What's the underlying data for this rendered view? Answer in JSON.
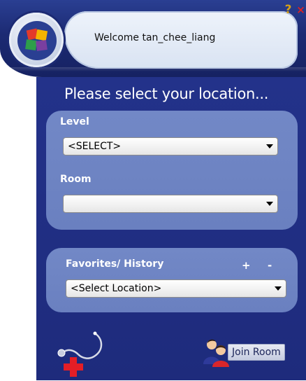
{
  "header": {
    "welcome_text": "Welcome tan_chee_liang",
    "logo_icon": "app-logo-icon",
    "help_glyph": "?",
    "close_glyph": "×"
  },
  "panel": {
    "title": "Please select your location...",
    "level": {
      "label": "Level",
      "selected": "<SELECT>"
    },
    "room": {
      "label": "Room",
      "selected": ""
    },
    "favorites": {
      "label": "Favorites/ History",
      "add_glyph": "+",
      "remove_glyph": "-",
      "selected": "<Select Location>"
    }
  },
  "footer": {
    "medical_icon": "stethoscope-cross-icon",
    "join_icon": "users-icon",
    "join_label": "Join Room"
  },
  "colors": {
    "header_bg": "#1c2a73",
    "panel_bg": "#1e2b7c",
    "card_bg": "#6e84c3",
    "help": "#d4a017",
    "close": "#e02020",
    "cross_red": "#e41e26"
  }
}
